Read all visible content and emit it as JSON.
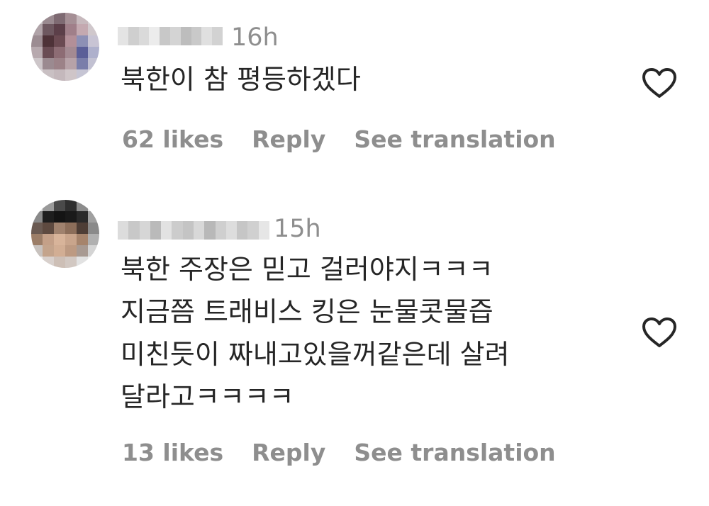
{
  "comments": [
    {
      "timestamp": "16h",
      "text": "북한이 참 평등하겠다",
      "likes": "62 likes",
      "reply_label": "Reply",
      "translate_label": "See translation",
      "avatar_icon": "blurred-avatar",
      "like_icon": "heart-outline-icon"
    },
    {
      "timestamp": "15h",
      "text": "북한 주장은 믿고 걸러야지ㅋㅋㅋ\n지금쯤 트래비스 킹은 눈물콧물즙\n미친듯이 짜내고있을꺼같은데 살려\n달라고ㅋㅋㅋㅋ",
      "likes": "13 likes",
      "reply_label": "Reply",
      "translate_label": "See translation",
      "avatar_icon": "blurred-avatar",
      "like_icon": "heart-outline-icon"
    }
  ],
  "colors": {
    "text": "#262626",
    "muted": "#8e8e8e",
    "background": "#ffffff"
  }
}
